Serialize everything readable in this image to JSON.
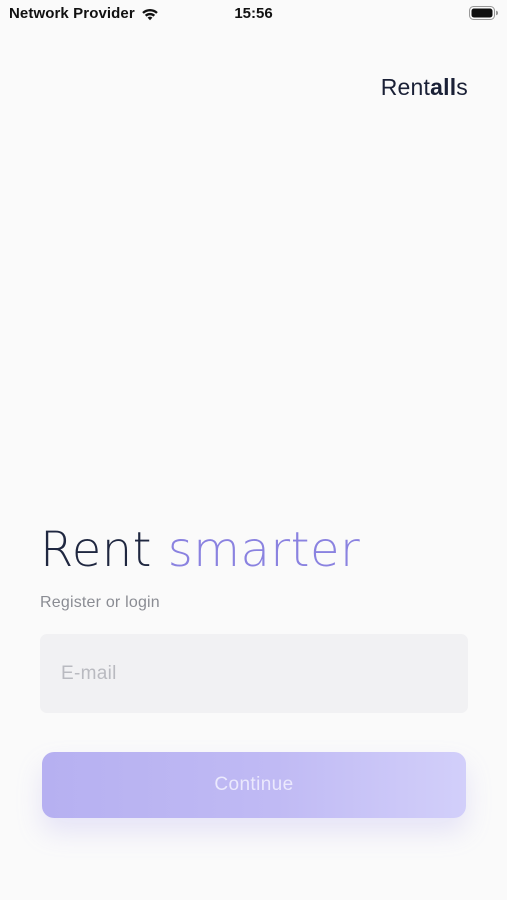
{
  "status_bar": {
    "carrier": "Network Provider",
    "time": "15:56",
    "icons": [
      "wifi-icon",
      "battery-icon"
    ]
  },
  "logo": {
    "part1": "Rent",
    "part2": "all",
    "part3": "s"
  },
  "hero": {
    "title_word1": "Rent",
    "title_word2": "smarter",
    "subtitle": "Register or login"
  },
  "form": {
    "email_placeholder": "E-mail",
    "email_value": "",
    "continue_label": "Continue"
  },
  "colors": {
    "background": "#fafafa",
    "title_dark": "#1f2740",
    "accent": "#8a82e0",
    "button_gradient_start": "#b6b0f1",
    "button_gradient_end": "#d2cffa",
    "input_background": "#f1f1f3"
  }
}
